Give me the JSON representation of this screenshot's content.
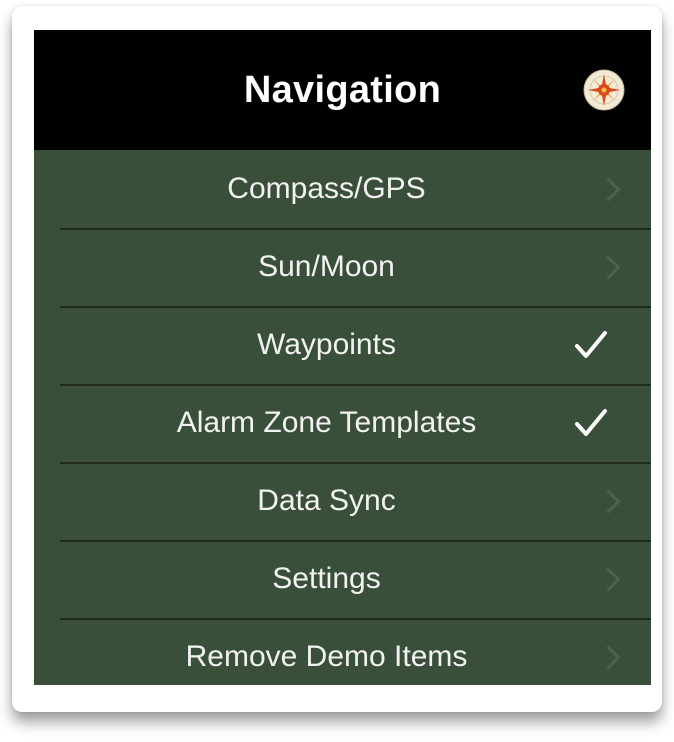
{
  "header": {
    "title": "Navigation",
    "icon": "compass-rose-icon"
  },
  "menu": {
    "items": [
      {
        "label": "Compass/GPS",
        "accessory": "chevron"
      },
      {
        "label": "Sun/Moon",
        "accessory": "chevron"
      },
      {
        "label": "Waypoints",
        "accessory": "checkmark"
      },
      {
        "label": "Alarm Zone Templates",
        "accessory": "checkmark"
      },
      {
        "label": "Data Sync",
        "accessory": "chevron"
      },
      {
        "label": "Settings",
        "accessory": "chevron"
      },
      {
        "label": "Remove Demo Items",
        "accessory": "chevron"
      }
    ]
  },
  "colors": {
    "header_bg": "#000000",
    "menu_bg": "#3a4f3a",
    "separator": "#1f2b1f",
    "text": "#f2f2f2",
    "checkmark": "#ffffff",
    "chevron": "#4d624d"
  }
}
